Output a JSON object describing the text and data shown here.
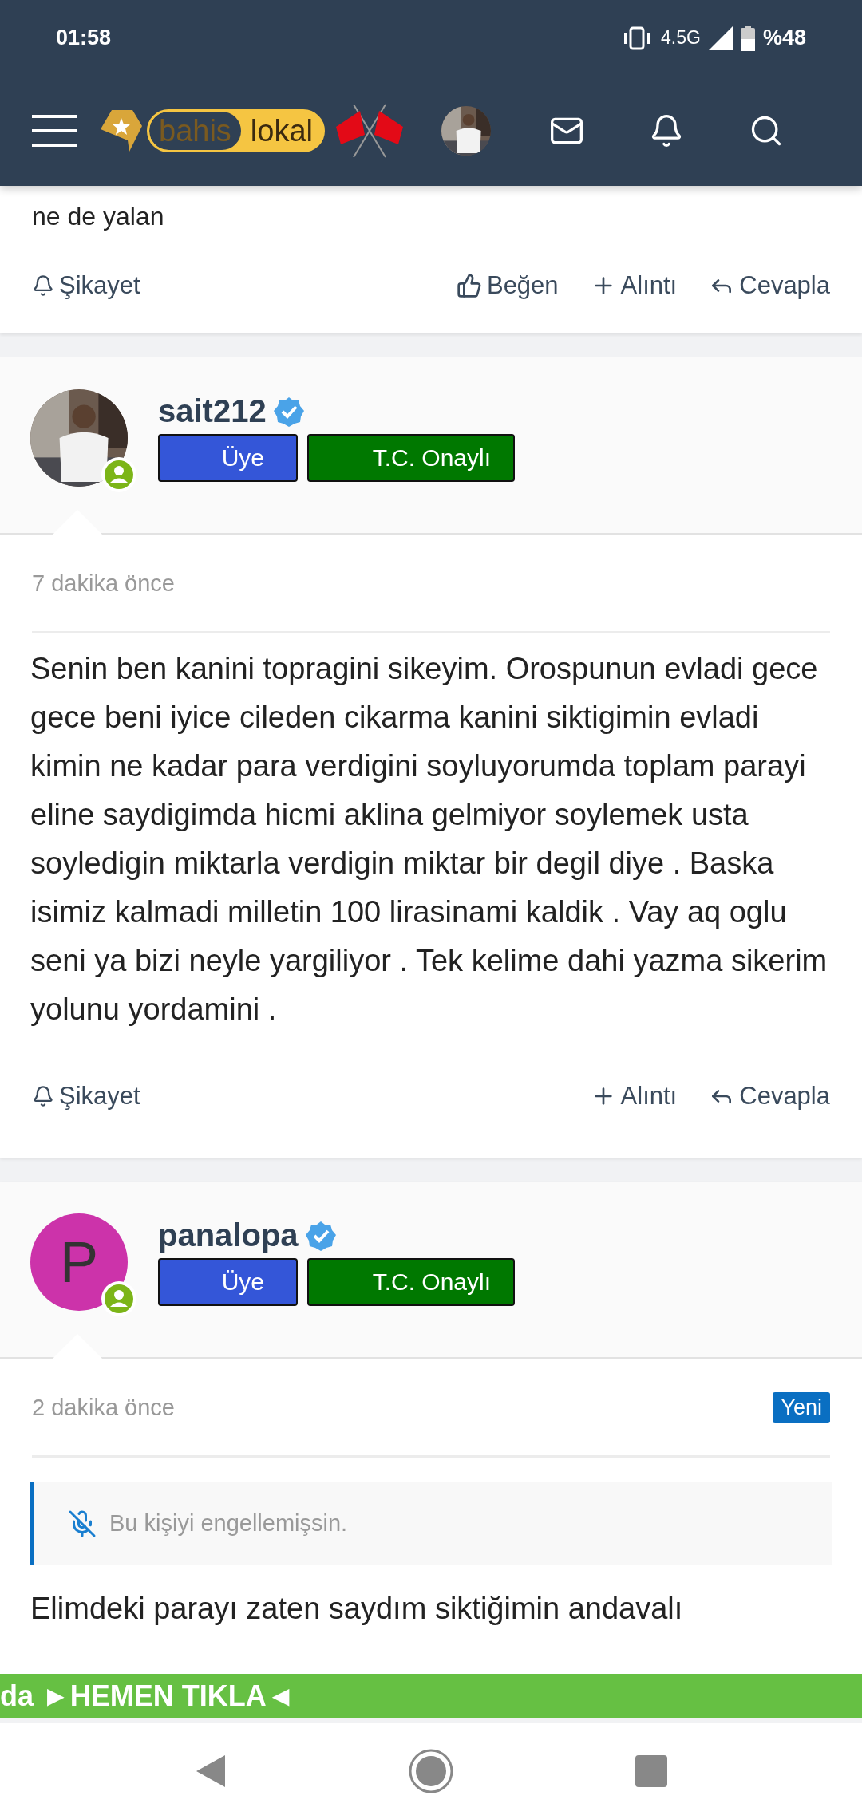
{
  "status_bar": {
    "time": "01:58",
    "network": "4.5G",
    "battery": "%48"
  },
  "header": {
    "logo": [
      "bahis",
      "lokal"
    ]
  },
  "previous_post": {
    "body_end": "ne de yalan",
    "actions": [
      {
        "kind": "report",
        "label": "Şikayet"
      },
      {
        "kind": "like",
        "label": "Beğen"
      },
      {
        "kind": "quote",
        "label": "Alıntı"
      },
      {
        "kind": "reply",
        "label": "Cevapla"
      }
    ]
  },
  "posts": [
    {
      "username": "sait212",
      "verified": true,
      "online": true,
      "avatar": {
        "kind": "picture"
      },
      "badges": [
        {
          "label": "Üye",
          "color": "#3456d8"
        },
        {
          "label": "T.C. Onaylı",
          "color": "#007800"
        }
      ],
      "time": "7 dakika önce",
      "new": false,
      "body": "Senin ben kanini topragini sikeyim. Orospunun evladi gece gece beni iyice cileden cikarma kanini siktigimin evladi kimin ne kadar para verdigini soyluyorumda toplam parayi eline saydigimda hicmi aklina gelmiyor soylemek usta soyledigin miktarla verdigin miktar bir degil diye . Baska isimiz kalmadi milletin 100 lirasinami kaldik . Vay aq oglu seni ya bizi neyle yargiliyor . Tek kelime dahi yazma sikerim yolunu yordamini .",
      "actions": [
        {
          "kind": "report",
          "label": "Şikayet"
        },
        {
          "kind": "quote",
          "label": "Alıntı"
        },
        {
          "kind": "reply",
          "label": "Cevapla"
        }
      ]
    },
    {
      "username": "panalopa",
      "verified": true,
      "online": true,
      "avatar": {
        "kind": "letter",
        "letter": "P",
        "color": "#cc33aa"
      },
      "badges": [
        {
          "label": "Üye",
          "color": "#3456d8"
        },
        {
          "label": "T.C. Onaylı",
          "color": "#007800"
        }
      ],
      "time": "2 dakika önce",
      "new": true,
      "new_label": "Yeni",
      "notice": "Bu kişiyi engellemişsin.",
      "body": "Elimdeki parayı zaten saydım siktiğimin andavalı"
    }
  ],
  "banner": {
    "text": "da ►HEMEN TIKLA◄"
  }
}
